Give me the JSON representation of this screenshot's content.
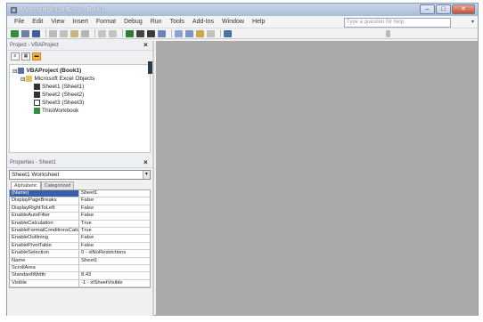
{
  "title": "Microsoft Visual Basic - Book1",
  "window_controls": {
    "minimize": "–",
    "maximize": "□",
    "close": "✕"
  },
  "menu": [
    "File",
    "Edit",
    "View",
    "Insert",
    "Format",
    "Debug",
    "Run",
    "Tools",
    "Add-Ins",
    "Window",
    "Help"
  ],
  "help_placeholder": "Type a question for help",
  "colors": {
    "titlebar": "#a9bbd6",
    "workspace": "#aaaaaa",
    "selection": "#3b5fa6",
    "active_tool": "#f3b446"
  },
  "project_pane": {
    "title": "Project - VBAProject",
    "close": "×",
    "tree": [
      {
        "label": "VBAProject (Book1)",
        "icon": "vba-project-icon",
        "level": 0,
        "expander": "⊟"
      },
      {
        "label": "Microsoft Excel Objects",
        "icon": "folder-icon",
        "level": 1,
        "expander": "⊟"
      },
      {
        "label": "Sheet1 (Sheet1)",
        "icon": "sheet-icon",
        "level": 2
      },
      {
        "label": "Sheet2 (Sheet2)",
        "icon": "sheet-icon",
        "level": 2
      },
      {
        "label": "Sheet3 (Sheet3)",
        "icon": "sheet-icon",
        "level": 2
      },
      {
        "label": "ThisWorkbook",
        "icon": "workbook-icon",
        "level": 2
      }
    ]
  },
  "properties_pane": {
    "title": "Properties - Sheet1",
    "close": "×",
    "object": "Sheet1 Worksheet",
    "tabs": [
      "Alphabetic",
      "Categorized"
    ],
    "rows": [
      {
        "name": "(Name)",
        "value": "Sheet1"
      },
      {
        "name": "DisplayPageBreaks",
        "value": "False"
      },
      {
        "name": "DisplayRightToLeft",
        "value": "False"
      },
      {
        "name": "EnableAutoFilter",
        "value": "False"
      },
      {
        "name": "EnableCalculation",
        "value": "True"
      },
      {
        "name": "EnableFormatConditionsCalculation",
        "value": "True"
      },
      {
        "name": "EnableOutlining",
        "value": "False"
      },
      {
        "name": "EnablePivotTable",
        "value": "False"
      },
      {
        "name": "EnableSelection",
        "value": "0 - xlNoRestrictions"
      },
      {
        "name": "Name",
        "value": "Sheet1"
      },
      {
        "name": "ScrollArea",
        "value": ""
      },
      {
        "name": "StandardWidth",
        "value": "8.43"
      },
      {
        "name": "Visible",
        "value": "-1 - xlSheetVisible"
      }
    ]
  }
}
